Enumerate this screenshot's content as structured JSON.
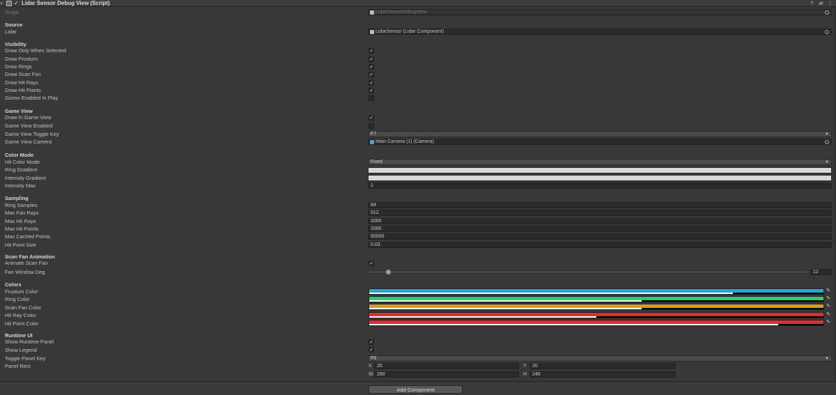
{
  "header": {
    "title": "Lidar Sensor Debug View (Script)",
    "icons": [
      "fold-icon",
      "script-icon",
      "help-icon",
      "presets-icon",
      "menu-icon"
    ]
  },
  "script_row": {
    "label": "Script",
    "value": "LidarSensorDebugView"
  },
  "sections": {
    "source": "Source",
    "visibility": "Visibility",
    "game_view": "Game View",
    "color_mode": "Color Mode",
    "sampling": "Sampling",
    "scan_fan_animation": "Scan Fan Animation",
    "colors": "Colors",
    "runtime_ui": "Runtime UI"
  },
  "source": {
    "lidar_label": "Lidar",
    "lidar_value": "LidarSensor (Lidar Component)"
  },
  "visibility": {
    "rows": [
      {
        "label": "Draw Only When Selected",
        "checked": true
      },
      {
        "label": "Draw Frustum",
        "checked": true
      },
      {
        "label": "Draw Rings",
        "checked": true
      },
      {
        "label": "Draw Scan Fan",
        "checked": true
      },
      {
        "label": "Draw Hit Rays",
        "checked": true
      },
      {
        "label": "Draw Hit Points",
        "checked": true
      },
      {
        "label": "Gizmo Enabled In Play",
        "checked": false
      }
    ]
  },
  "game_view": {
    "draw_in_game_view_label": "Draw In Game View",
    "draw_in_game_view": true,
    "game_view_enabled_label": "Game View Enabled",
    "game_view_enabled": false,
    "toggle_key_label": "Game View Toggle Key",
    "toggle_key_value": "F7",
    "camera_label": "Game View Camera",
    "camera_value": "Main Camera (1) (Camera)"
  },
  "color_mode": {
    "hit_color_mode_label": "Hit Color Mode",
    "hit_color_mode_value": "Fixed",
    "ring_gradient_label": "Ring Gradient",
    "intensity_gradient_label": "Intensity Gradient",
    "intensity_max_label": "Intensity Max",
    "intensity_max_value": "1"
  },
  "sampling": {
    "rows": [
      {
        "label": "Ring Samples",
        "value": "64"
      },
      {
        "label": "Max Fan Rays",
        "value": "512"
      },
      {
        "label": "Max Hit Rays",
        "value": "2000"
      },
      {
        "label": "Max Hit Points",
        "value": "2000"
      },
      {
        "label": "Max Cached Points",
        "value": "50000"
      },
      {
        "label": "Hit Point Size",
        "value": "0.03"
      }
    ]
  },
  "scan_fan": {
    "animate_label": "Animate Scan Fan",
    "animate": true,
    "window_label": "Fan Window Deg",
    "window_value": "12",
    "window_fraction": 0.04
  },
  "colors": {
    "rows": [
      {
        "label": "Frustum Color",
        "color": "#29a6d8",
        "alpha": 0.8
      },
      {
        "label": "Ring Color",
        "color": "#2dcc72",
        "alpha": 0.6
      },
      {
        "label": "Scan Fan Color",
        "color": "#d69b2e",
        "alpha": 0.6
      },
      {
        "label": "Hit Ray Color",
        "color": "#dd2f2f",
        "alpha": 0.5
      },
      {
        "label": "Hit Point Color",
        "color": "#dd2f2f",
        "alpha": 0.9
      }
    ]
  },
  "runtime_ui": {
    "show_runtime_panel_label": "Show Runtime Panel",
    "show_runtime_panel": true,
    "show_legend_label": "Show Legend",
    "show_legend": true,
    "toggle_panel_key_label": "Toggle Panel Key",
    "toggle_panel_key_value": "F8",
    "panel_rect_label": "Panel Rect",
    "rect": {
      "x_label": "X",
      "x": "20",
      "y_label": "Y",
      "y": "20",
      "w_label": "W",
      "w": "260",
      "h_label": "H",
      "h": "240"
    }
  },
  "footer": {
    "add_component": "Add Component"
  }
}
